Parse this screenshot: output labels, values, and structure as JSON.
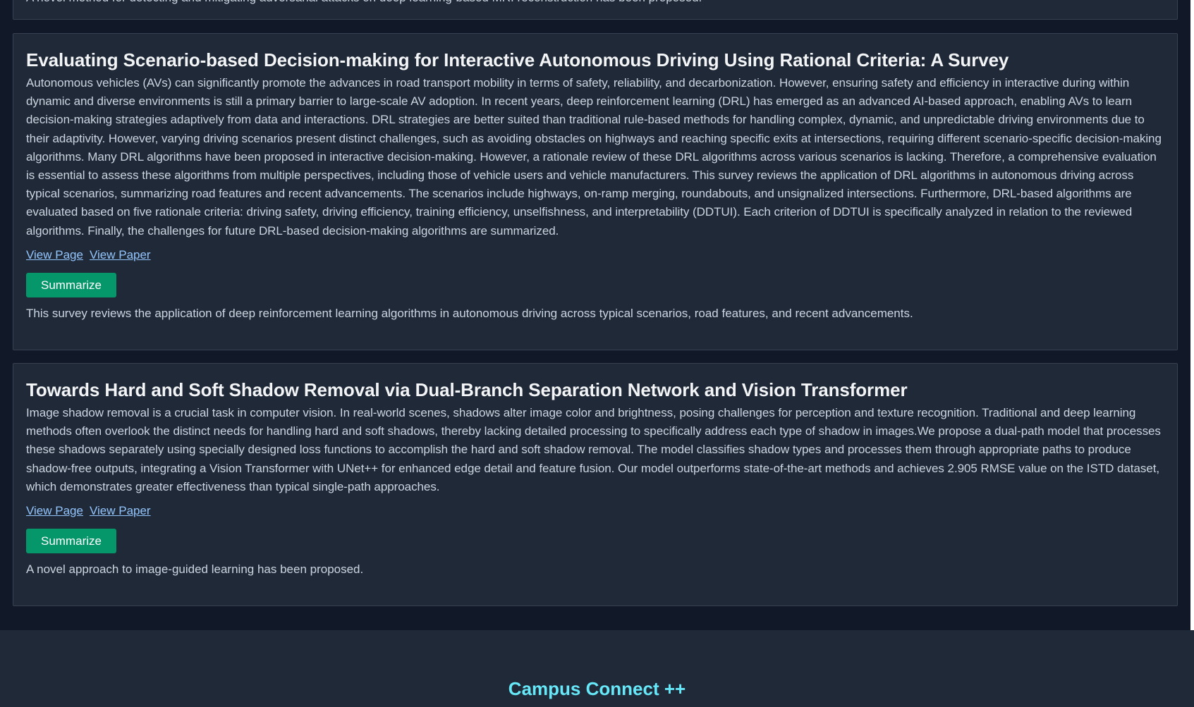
{
  "previous_card": {
    "summary": "A novel method for detecting and mitigating adversarial attacks on deep learning-based MRI reconstruction has been proposed."
  },
  "papers": [
    {
      "title": "Evaluating Scenario-based Decision-making for Interactive Autonomous Driving Using Rational Criteria: A Survey",
      "abstract": "Autonomous vehicles (AVs) can significantly promote the advances in road transport mobility in terms of safety, reliability, and decarbonization. However, ensuring safety and efficiency in interactive during within dynamic and diverse environments is still a primary barrier to large-scale AV adoption. In recent years, deep reinforcement learning (DRL) has emerged as an advanced AI-based approach, enabling AVs to learn decision-making strategies adaptively from data and interactions. DRL strategies are better suited than traditional rule-based methods for handling complex, dynamic, and unpredictable driving environments due to their adaptivity. However, varying driving scenarios present distinct challenges, such as avoiding obstacles on highways and reaching specific exits at intersections, requiring different scenario-specific decision-making algorithms. Many DRL algorithms have been proposed in interactive decision-making. However, a rationale review of these DRL algorithms across various scenarios is lacking. Therefore, a comprehensive evaluation is essential to assess these algorithms from multiple perspectives, including those of vehicle users and vehicle manufacturers. This survey reviews the application of DRL algorithms in autonomous driving across typical scenarios, summarizing road features and recent advancements. The scenarios include highways, on-ramp merging, roundabouts, and unsignalized intersections. Furthermore, DRL-based algorithms are evaluated based on five rationale criteria: driving safety, driving efficiency, training efficiency, unselfishness, and interpretability (DDTUI). Each criterion of DDTUI is specifically analyzed in relation to the reviewed algorithms. Finally, the challenges for future DRL-based decision-making algorithms are summarized.",
      "view_page_label": "View Page",
      "view_paper_label": "View Paper",
      "summarize_label": "Summarize",
      "summary": "This survey reviews the application of deep reinforcement learning algorithms in autonomous driving across typical scenarios, road features, and recent advancements."
    },
    {
      "title": "Towards Hard and Soft Shadow Removal via Dual-Branch Separation Network and Vision Transformer",
      "abstract": "Image shadow removal is a crucial task in computer vision. In real-world scenes, shadows alter image color and brightness, posing challenges for perception and texture recognition. Traditional and deep learning methods often overlook the distinct needs for handling hard and soft shadows, thereby lacking detailed processing to specifically address each type of shadow in images.We propose a dual-path model that processes these shadows separately using specially designed loss functions to accomplish the hard and soft shadow removal. The model classifies shadow types and processes them through appropriate paths to produce shadow-free outputs, integrating a Vision Transformer with UNet++ for enhanced edge detail and feature fusion. Our model outperforms state-of-the-art methods and achieves 2.905 RMSE value on the ISTD dataset, which demonstrates greater effectiveness than typical single-path approaches.",
      "view_page_label": "View Page",
      "view_paper_label": "View Paper",
      "summarize_label": "Summarize",
      "summary": "A novel approach to image-guided learning has been proposed."
    }
  ],
  "footer": {
    "brand": "Campus Connect ++"
  },
  "colors": {
    "page_background": "#111827",
    "card_background": "#1f2937",
    "card_border": "#374151",
    "title_text": "#f3f4f6",
    "body_text": "#cbd5e1",
    "link": "#93c5fd",
    "button": "#059669",
    "footer_brand": "#67e8f9"
  }
}
